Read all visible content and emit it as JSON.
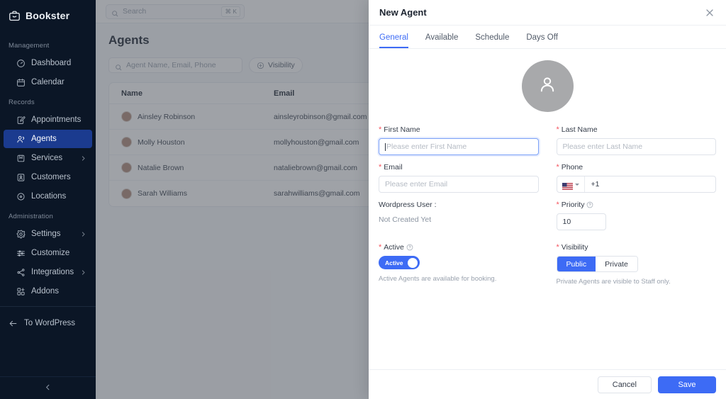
{
  "sidebar": {
    "brand": "Bookster",
    "brand_icon": "briefcase-smile-icon",
    "sections": [
      {
        "title": "Management",
        "items": [
          {
            "label": "Dashboard",
            "icon": "gauge-icon",
            "chevron": false,
            "active": false
          },
          {
            "label": "Calendar",
            "icon": "calendar-icon",
            "chevron": false,
            "active": false
          }
        ]
      },
      {
        "title": "Records",
        "items": [
          {
            "label": "Appointments",
            "icon": "edit-note-icon",
            "chevron": true,
            "active": false
          },
          {
            "label": "Agents",
            "icon": "users-icon",
            "chevron": false,
            "active": true
          },
          {
            "label": "Services",
            "icon": "box-icon",
            "chevron": true,
            "active": false
          },
          {
            "label": "Customers",
            "icon": "contact-card-icon",
            "chevron": false,
            "active": false
          },
          {
            "label": "Locations",
            "icon": "map-pin-icon",
            "chevron": false,
            "active": false
          }
        ]
      },
      {
        "title": "Administration",
        "items": [
          {
            "label": "Settings",
            "icon": "gear-icon",
            "chevron": true,
            "active": false
          },
          {
            "label": "Customize",
            "icon": "sliders-icon",
            "chevron": false,
            "active": false
          },
          {
            "label": "Integrations",
            "icon": "share-nodes-icon",
            "chevron": true,
            "active": false
          },
          {
            "label": "Addons",
            "icon": "grid-plus-icon",
            "chevron": false,
            "active": false
          }
        ]
      }
    ],
    "footer_link": "To WordPress",
    "footer_icon": "arrow-left-icon",
    "collapse_icon": "chevron-left-icon",
    "active_bg": "#1b3b8f",
    "bg": "#0b1626"
  },
  "topbar": {
    "search_placeholder": "Search",
    "search_icon": "search-icon",
    "shortcut": "⌘ K"
  },
  "main": {
    "page_title": "Agents",
    "filter_placeholder": "Agent Name, Email, Phone",
    "filter_icon": "search-icon",
    "visibility_chip": "Visibility",
    "visibility_chip_icon": "plus-circle-icon",
    "table": {
      "columns": [
        "Name",
        "Email"
      ],
      "rows": [
        {
          "name": "Ainsley Robinson",
          "email": "ainsleyrobinson@gmail.com"
        },
        {
          "name": "Molly Houston",
          "email": "mollyhouston@gmail.com"
        },
        {
          "name": "Natalie Brown",
          "email": "nataliebrown@gmail.com"
        },
        {
          "name": "Sarah Williams",
          "email": "sarahwilliams@gmail.com"
        }
      ]
    }
  },
  "modal": {
    "title": "New Agent",
    "close_icon": "close-icon",
    "tabs": [
      {
        "label": "General",
        "active": true
      },
      {
        "label": "Available",
        "active": false
      },
      {
        "label": "Schedule",
        "active": false
      },
      {
        "label": "Days Off",
        "active": false
      }
    ],
    "avatar_icon": "person-icon",
    "avatar_color": "#a8a9ab",
    "fields": {
      "first_name": {
        "label": "First Name",
        "placeholder": "Please enter First Name",
        "value": "",
        "required": true,
        "focused": true
      },
      "last_name": {
        "label": "Last Name",
        "placeholder": "Please enter Last Name",
        "value": "",
        "required": true
      },
      "email": {
        "label": "Email",
        "placeholder": "Please enter Email",
        "value": "",
        "required": true
      },
      "phone": {
        "label": "Phone",
        "country_flag": "us-flag-icon",
        "dial_code": "+1",
        "required": true
      },
      "wordpress_user": {
        "label": "Wordpress User :",
        "value": "Not Created Yet"
      },
      "priority": {
        "label": "Priority",
        "value": "10",
        "required": true,
        "help": true
      },
      "active": {
        "label": "Active",
        "toggle_text": "Active",
        "on": true,
        "required": true,
        "help": true,
        "hint": "Active Agents are available for booking."
      },
      "visibility": {
        "label": "Visibility",
        "required": true,
        "options": [
          "Public",
          "Private"
        ],
        "selected": "Public",
        "hint": "Private Agents are visible to Staff only."
      }
    },
    "footer": {
      "cancel": "Cancel",
      "save": "Save"
    },
    "accent": "#3d6bf5"
  }
}
